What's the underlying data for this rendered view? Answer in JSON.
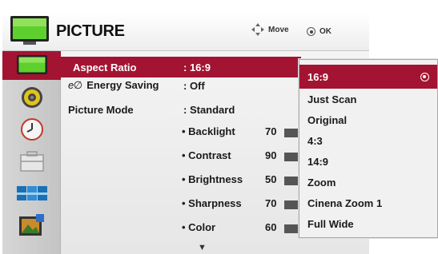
{
  "header": {
    "title": "PICTURE",
    "move_label": "Move",
    "ok_label": "OK"
  },
  "sidebar": {
    "items": [
      {
        "icon": "picture-icon",
        "selected": true
      },
      {
        "icon": "audio-speaker-icon",
        "selected": false
      },
      {
        "icon": "time-clock-icon",
        "selected": false
      },
      {
        "icon": "option-toolbox-icon",
        "selected": false
      },
      {
        "icon": "input-screens-icon",
        "selected": false
      },
      {
        "icon": "photo-media-icon",
        "selected": false
      }
    ]
  },
  "menu": {
    "rows": [
      {
        "label": "Aspect Ratio",
        "value": ": 16:9"
      },
      {
        "label": "Energy Saving",
        "prefix": "e∅",
        "value": ": Off"
      },
      {
        "label": "Picture Mode",
        "value": ": Standard"
      }
    ],
    "sub_rows": [
      {
        "label": "• Backlight",
        "value": "70"
      },
      {
        "label": "• Contrast",
        "value": "90"
      },
      {
        "label": "• Brightness",
        "value": "50"
      },
      {
        "label": "• Sharpness",
        "value": "70"
      },
      {
        "label": "• Color",
        "value": "60"
      }
    ],
    "scroll_glyph": "▼"
  },
  "dropdown": {
    "options": [
      "16:9",
      "Just Scan",
      "Original",
      "4:3",
      "14:9",
      "Zoom",
      "Cinena Zoom 1",
      "Full Wide"
    ],
    "selected_index": 0
  },
  "colors": {
    "selection": "#a31432",
    "panel": "#eeeeee"
  }
}
